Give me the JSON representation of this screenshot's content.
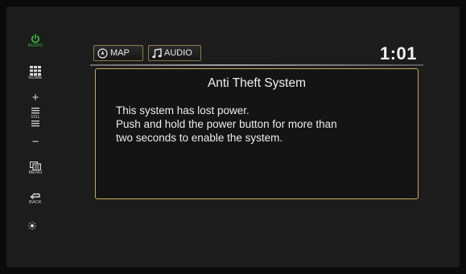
{
  "sidebar": {
    "audio_label": "AUDIO",
    "home_label": "HOME",
    "vol_label": "VOL",
    "menu_label": "MENU",
    "back_label": "BACK",
    "plus_glyph": "+",
    "minus_glyph": "−"
  },
  "header": {
    "tabs": [
      {
        "label": "MAP",
        "icon": "compass-icon"
      },
      {
        "label": "AUDIO",
        "icon": "music-note-icon"
      }
    ],
    "clock": "1:01"
  },
  "dialog": {
    "title": "Anti Theft System",
    "lines": [
      "This system has lost power.",
      "Push and hold the power button for more than",
      "two seconds to enable the system."
    ]
  },
  "colors": {
    "power_icon": "#3fbf3f",
    "dialog_border": "#c8ad5c",
    "background": "#1c1c1c"
  }
}
